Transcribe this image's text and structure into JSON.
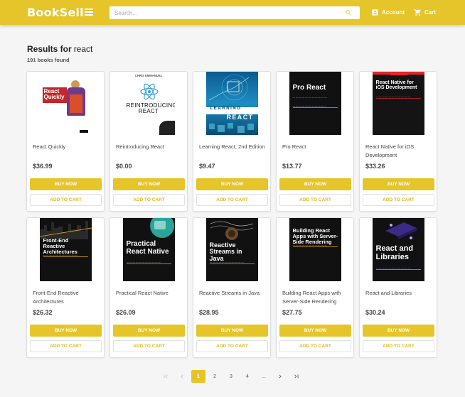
{
  "header": {
    "logo": "BookSell",
    "search_placeholder": "Search...",
    "account_label": "Account",
    "cart_label": "Cart",
    "accent": "#e5c52a"
  },
  "results": {
    "label": "Results for",
    "query": "react",
    "count": "191 books found"
  },
  "books": [
    {
      "title": "React Quickly",
      "price": "$36.99",
      "buy": "BUY NOW",
      "add": "ADD TO CART",
      "cover": {
        "title": "React Quickly",
        "bg": "#ffffff",
        "accent": "#c3262b"
      }
    },
    {
      "title": "Reintroducing React",
      "price": "$0.00",
      "buy": "BUY NOW",
      "add": "ADD TO CART",
      "cover": {
        "author": "CHRIS EMMANUEL",
        "title": "REINTRODUCING REACT",
        "bg": "#ffffff",
        "accent": "#2f9ad8"
      }
    },
    {
      "title": "Learning React, 2nd Edition",
      "price": "$9.47",
      "buy": "BUY NOW",
      "add": "ADD TO CART",
      "cover": {
        "top": "LEARNING",
        "title": "REACT",
        "bg": "#1a6ba3",
        "accent": "#4fd0e6"
      }
    },
    {
      "title": "Pro React",
      "price": "$13.77",
      "buy": "BUY NOW",
      "add": "ADD TO CART",
      "cover": {
        "title": "Pro React",
        "bg": "#111111",
        "accent": "#f0b400"
      }
    },
    {
      "title": "React Native for iOS Development",
      "price": "$33.26",
      "buy": "BUY NOW",
      "add": "ADD TO CART",
      "cover": {
        "title": "React Native for iOS Development",
        "bg": "#141414",
        "accent": "#e4262a"
      }
    },
    {
      "title": "Front-End Reactive Architectures",
      "price": "$26.32",
      "buy": "BUY NOW",
      "add": "ADD TO CART",
      "cover": {
        "title": "Front-End Reactive Architectures",
        "bg": "#111111",
        "accent": "#f0b400"
      }
    },
    {
      "title": "Practical React Native",
      "price": "$26.09",
      "buy": "BUY NOW",
      "add": "ADD TO CART",
      "cover": {
        "title": "Practical React Native",
        "bg": "#111111",
        "accent": "#f0b400"
      }
    },
    {
      "title": "Reactive Streams in Java",
      "price": "$28.95",
      "buy": "BUY NOW",
      "add": "ADD TO CART",
      "cover": {
        "title": "Reactive Streams in Java",
        "bg": "#111111",
        "accent": "#f0b400"
      }
    },
    {
      "title": "Building React Apps with Server-Side Rendering",
      "price": "$27.75",
      "buy": "BUY NOW",
      "add": "ADD TO CART",
      "cover": {
        "title": "Building React Apps with Server-Side Rendering",
        "bg": "#111111",
        "accent": "#f0b400"
      }
    },
    {
      "title": "React and Libraries",
      "price": "$30.24",
      "buy": "BUY NOW",
      "add": "ADD TO CART",
      "cover": {
        "title": "React and Libraries",
        "bg": "#111111",
        "accent": "#f0b400"
      }
    }
  ],
  "pagination": {
    "pages": [
      "1",
      "2",
      "3",
      "4",
      "..."
    ],
    "current": "1"
  }
}
